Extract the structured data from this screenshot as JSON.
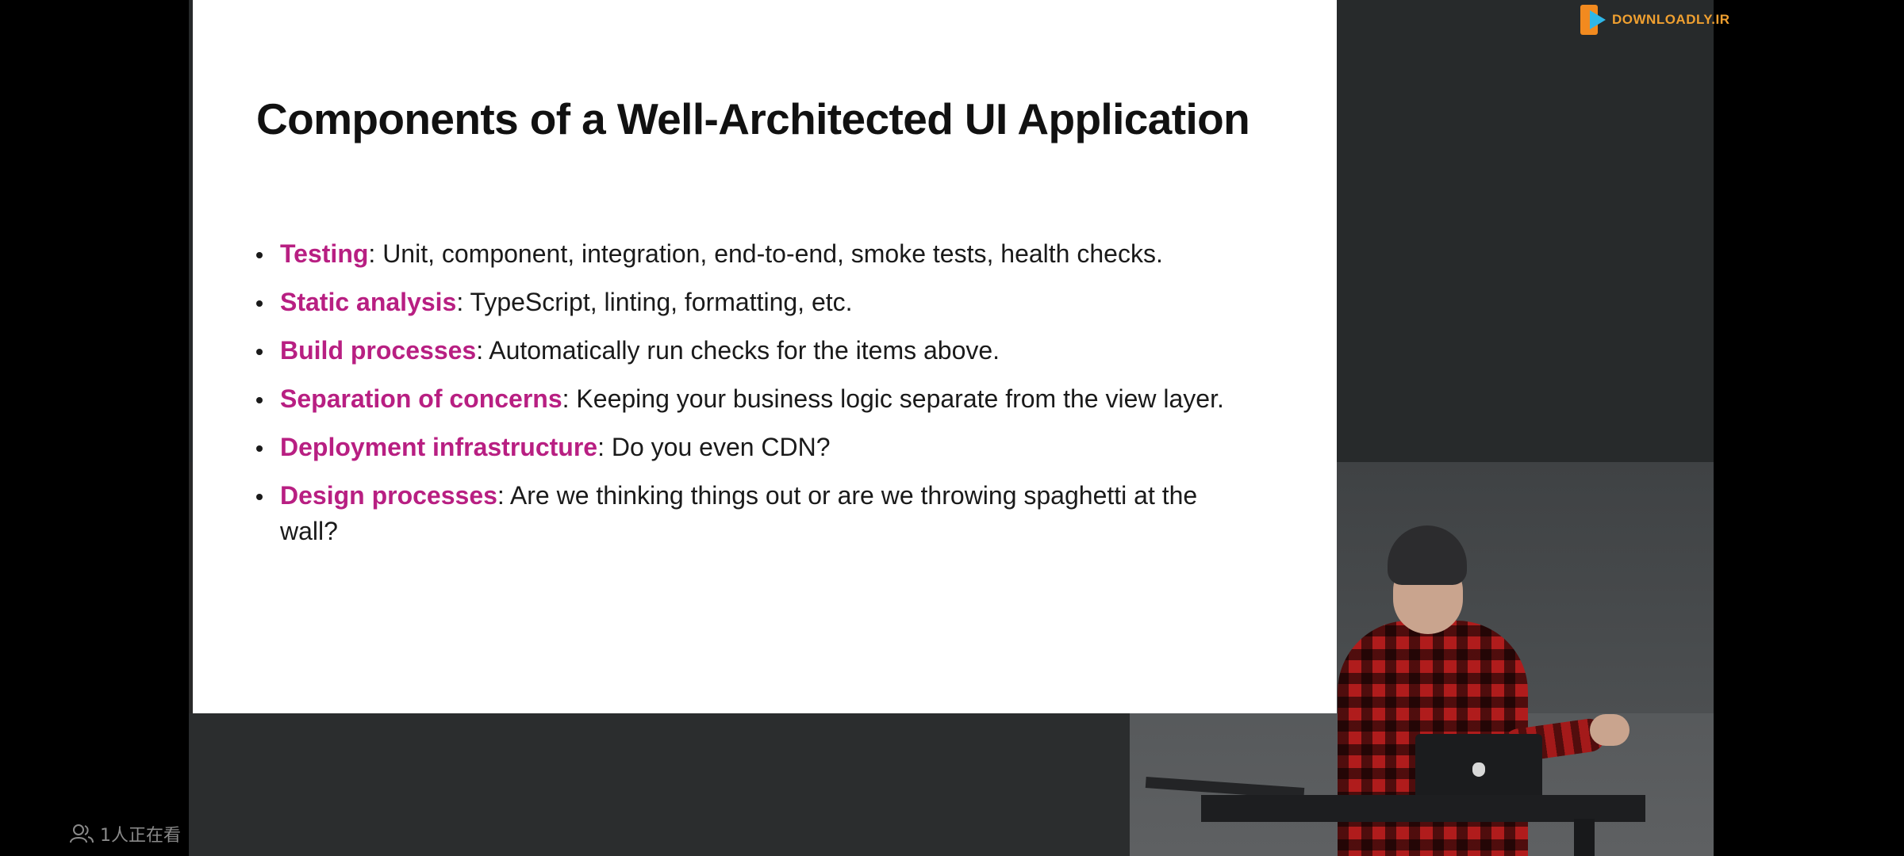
{
  "slide": {
    "title": "Components of a Well-Architected UI Application",
    "bullets": [
      {
        "term": "Testing",
        "text": ": Unit, component, integration, end-to-end, smoke tests, health checks."
      },
      {
        "term": "Static analysis",
        "text": ": TypeScript, linting, formatting, etc."
      },
      {
        "term": "Build processes",
        "text": ": Automatically run checks for the items above."
      },
      {
        "term": "Separation of concerns",
        "text": ": Keeping your business logic separate from the view layer."
      },
      {
        "term": "Deployment infrastructure",
        "text": ": Do you even CDN?"
      },
      {
        "term": "Design processes",
        "text": ": Are we thinking things out or are we throwing spaghetti at the wall?"
      }
    ]
  },
  "watermark": {
    "text": "DOWNLOADLY.IR"
  },
  "overlay": {
    "viewer_count": "1人正在看",
    "viewer_icon": "people-icon"
  },
  "colors": {
    "term_accent": "#b81f82",
    "slide_background": "#ffffff",
    "page_background": "#000000"
  }
}
